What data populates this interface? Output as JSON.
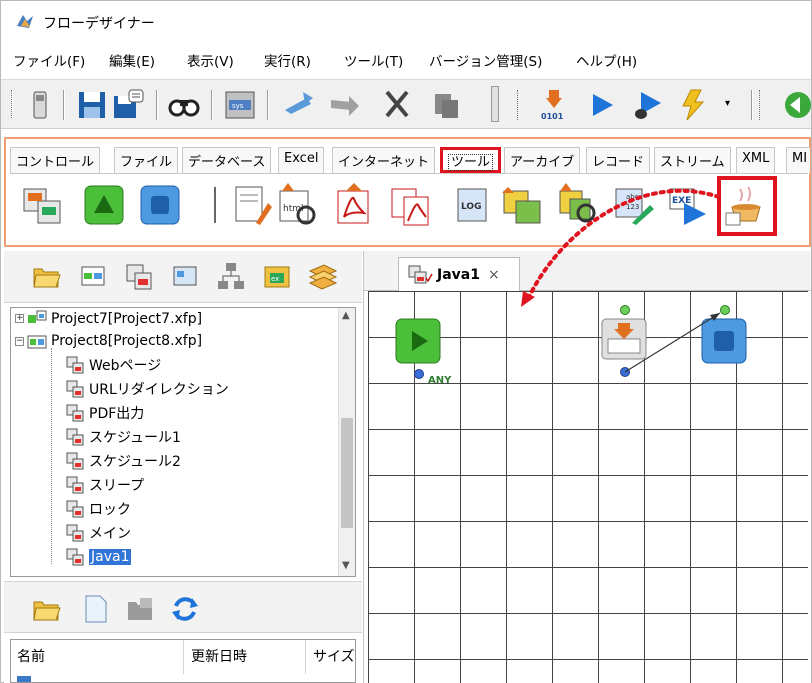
{
  "window": {
    "title": "フローデザイナー"
  },
  "menu": {
    "items": [
      "ファイル(F)",
      "編集(E)",
      "表示(V)",
      "実行(R)",
      "ツール(T)",
      "バージョン管理(S)",
      "ヘルプ(H)"
    ]
  },
  "toolbar": {
    "icons": [
      "phone-icon",
      "save-icon",
      "save-as-icon",
      "find-icon",
      "sys-icon",
      "undo-icon",
      "redo-icon",
      "cut-icon",
      "copy-icon",
      "compile-icon",
      "run-icon",
      "debug-icon",
      "build-icon",
      "back-icon"
    ]
  },
  "palette": {
    "tabs": [
      "コントロール",
      "ファイル",
      "データベース",
      "Excel",
      "インターネット",
      "ツール",
      "アーカイブ",
      "レコード",
      "ストリーム",
      "XML",
      "MI"
    ],
    "active_tab": "ツール",
    "icons": [
      "flow-icon",
      "start-icon",
      "end-icon",
      "note-icon",
      "html-icon",
      "pdf-icon",
      "pdf-merge-icon",
      "log-icon",
      "image-icon",
      "image-search-icon",
      "text-edit-icon",
      "exe-icon",
      "java-icon"
    ],
    "highlight_color": "#e0141e"
  },
  "project_tree": {
    "items": [
      {
        "label": "Project7[Project7.xfp]",
        "level": 0,
        "expanded": false
      },
      {
        "label": "Project8[Project8.xfp]",
        "level": 0,
        "expanded": true
      },
      {
        "label": "Webページ",
        "level": 1
      },
      {
        "label": "URLリダイレクション",
        "level": 1
      },
      {
        "label": "PDF出力",
        "level": 1
      },
      {
        "label": "スケジュール1",
        "level": 1
      },
      {
        "label": "スケジュール2",
        "level": 1
      },
      {
        "label": "スリープ",
        "level": 1
      },
      {
        "label": "ロック",
        "level": 1
      },
      {
        "label": "メイン",
        "level": 1
      },
      {
        "label": "Java1",
        "level": 1,
        "selected": true
      }
    ]
  },
  "file_table": {
    "columns": [
      "名前",
      "更新日時",
      "サイズ"
    ]
  },
  "editor": {
    "tab_label": "Java1",
    "close": "×",
    "start_node_label": "ANY"
  }
}
